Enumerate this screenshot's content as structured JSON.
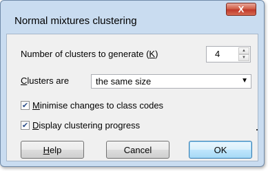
{
  "window": {
    "title": "Normal mixtures clustering",
    "close_glyph": "X"
  },
  "form": {
    "clusters_label_pre": "Number of clusters to generate (",
    "clusters_label_key": "K",
    "clusters_label_post": ")",
    "clusters_value": "4",
    "spin_up": "▲",
    "spin_down": "▼",
    "size_label_key": "C",
    "size_label_rest": "lusters are",
    "size_value": "the same size",
    "size_arrow": "▼",
    "minimise_checked": true,
    "minimise_label_key": "M",
    "minimise_label_rest": "inimise changes to class codes",
    "progress_checked": true,
    "progress_label_key": "D",
    "progress_label_rest": "isplay clustering progress",
    "check_glyph": "✔"
  },
  "buttons": {
    "help_key": "H",
    "help_rest": "elp",
    "cancel": "Cancel",
    "ok": "OK"
  },
  "colors": {
    "frame": "#c9dcf0",
    "client": "#f0f0f0",
    "close": "#c0392b",
    "default_button": "#bee6fd"
  }
}
